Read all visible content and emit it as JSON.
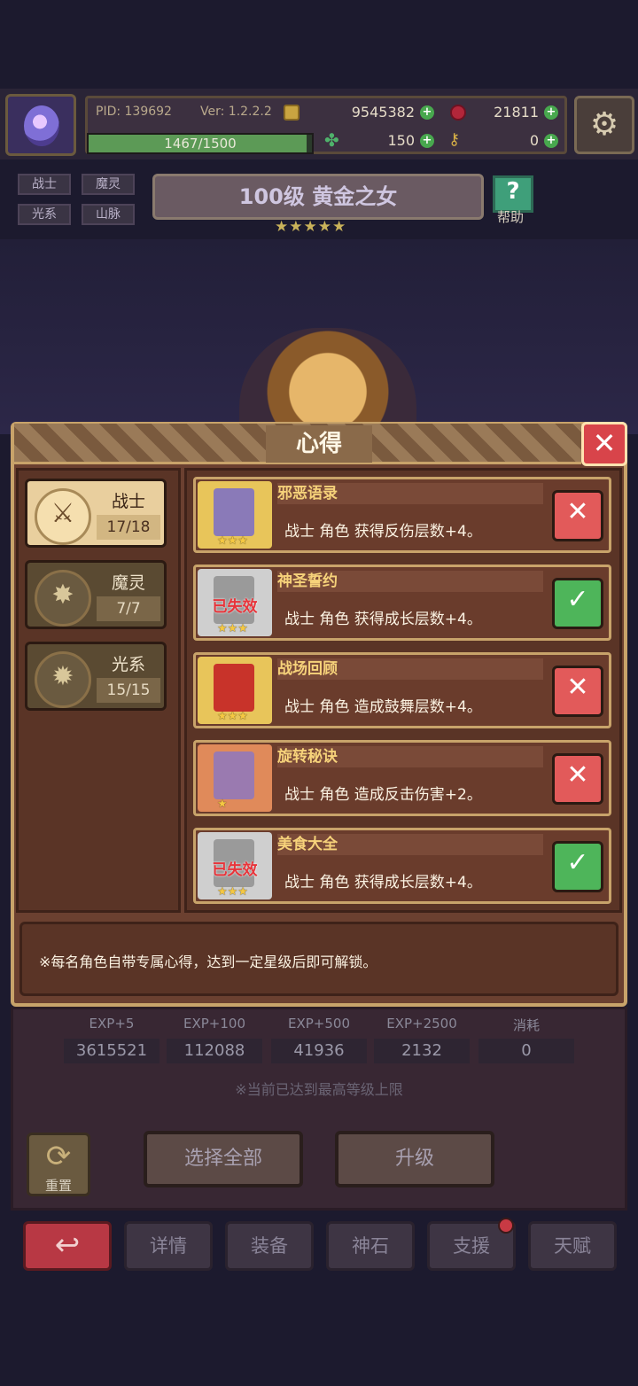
{
  "hud": {
    "pid": "PID: 139692",
    "version": "Ver: 1.2.2.2",
    "gold": "9545382",
    "gems": "21811",
    "xp": "1467/1500",
    "xp_progress": 0.978,
    "clover": "150",
    "keys": "0"
  },
  "tags": [
    "战士",
    "魔灵",
    "光系",
    "山脉"
  ],
  "hero": {
    "title": "100级  黄金之女",
    "stars": "★★★★★"
  },
  "help_label": "帮助",
  "modal": {
    "title": "心得",
    "categories": [
      {
        "name": "战士",
        "count": "17/18",
        "active": true,
        "icon": "sword-icon"
      },
      {
        "name": "魔灵",
        "count": "7/7",
        "active": false,
        "icon": "star-badge-icon"
      },
      {
        "name": "光系",
        "count": "15/15",
        "active": false,
        "icon": "sun-gear-icon"
      }
    ],
    "items": [
      {
        "name": "邪恶语录",
        "desc": "战士 角色 获得反伤层数+4。",
        "stars": "★★★",
        "lost": "",
        "enabled": false,
        "theme": "purple"
      },
      {
        "name": "神圣誓约",
        "desc": "战士 角色 获得成长层数+4。",
        "stars": "★★★",
        "lost": "已失效",
        "enabled": true,
        "theme": "grey"
      },
      {
        "name": "战场回顾",
        "desc": "战士 角色 造成鼓舞层数+4。",
        "stars": "★★★",
        "lost": "",
        "enabled": false,
        "theme": "gold"
      },
      {
        "name": "旋转秘诀",
        "desc": "战士 角色 造成反击伤害+2。",
        "stars": "★",
        "lost": "",
        "enabled": false,
        "theme": "orange"
      },
      {
        "name": "美食大全",
        "desc": "战士 角色 获得成长层数+4。",
        "stars": "★★★",
        "lost": "已失效",
        "enabled": true,
        "theme": "grey"
      }
    ],
    "note": "※每名角色自带专属心得，达到一定星级后即可解锁。"
  },
  "exp": {
    "labels": [
      "EXP+5",
      "EXP+100",
      "EXP+500",
      "EXP+2500",
      "消耗"
    ],
    "values": [
      "3615521",
      "112088",
      "41936",
      "2132",
      "0"
    ],
    "max_note": "※当前已达到最高等级上限"
  },
  "actions": {
    "reset": "重置",
    "select_all": "选择全部",
    "upgrade": "升级"
  },
  "tabs": [
    "详情",
    "装备",
    "神石",
    "支援",
    "天赋"
  ],
  "colors": {
    "accent": "#c8a36a",
    "enabled": "#4eb55a",
    "disabled": "#e25a5a",
    "lost": "#e8343a"
  }
}
